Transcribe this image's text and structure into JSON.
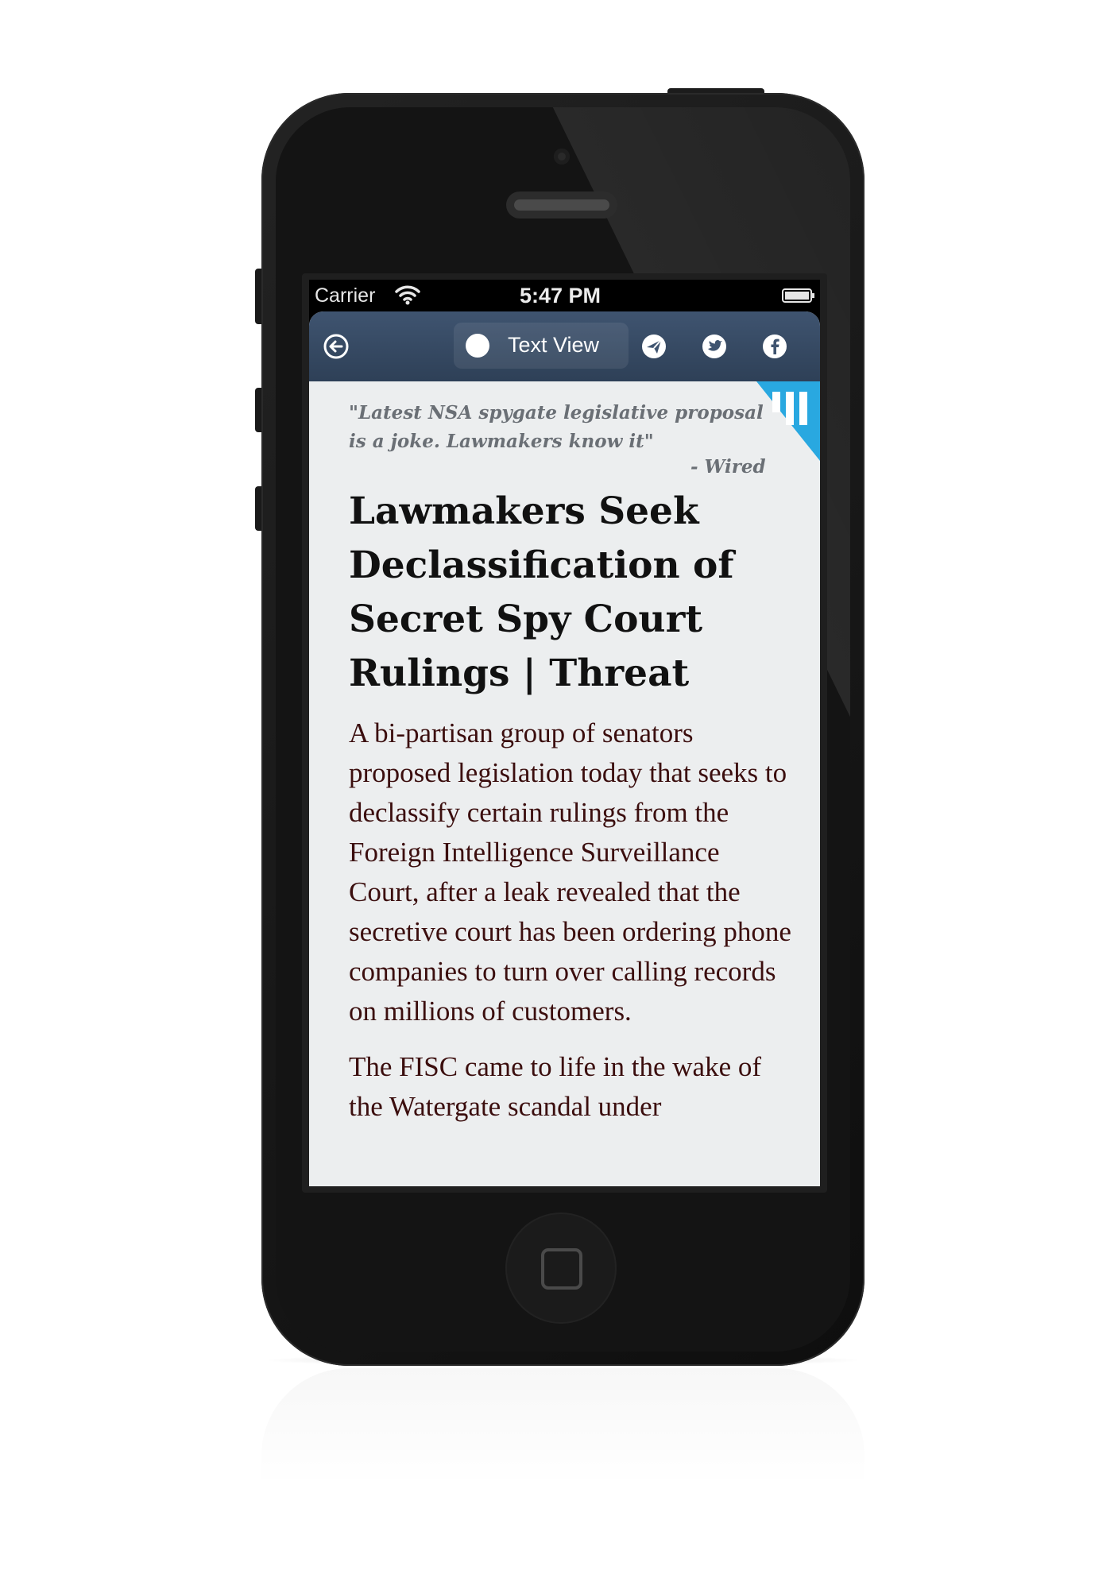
{
  "status_bar": {
    "carrier": "Carrier",
    "time": "5:47 PM",
    "wifi_icon": "wifi-icon",
    "battery_icon": "battery-icon"
  },
  "toolbar": {
    "back_icon": "back-arrow-icon",
    "text_view_label": "Text View",
    "text_view_icon": "white-dot-icon",
    "send_icon": "paper-plane-icon",
    "twitter_icon": "twitter-bird-icon",
    "facebook_icon": "facebook-icon",
    "bg_color": "#3f5470"
  },
  "article": {
    "quote": "\"Latest NSA spygate legislative proposal is a joke. Lawmakers know it\"",
    "quote_source": "- Wired",
    "headline": "Lawmakers Seek Declassification of Secret Spy Court Rulings | Threat",
    "paragraphs": [
      "A bi-partisan group of senators proposed legislation today that seeks to declassify certain rulings from the Foreign Intelligence Surveillance Court, after a leak revealed that the secretive court has been ordering phone companies to turn over calling records on millions of customers.",
      "The FISC came to life in the wake of the Watergate scandal under"
    ],
    "corner_badge_icon": "quote-flag-icon",
    "accent_color": "#29a8e0"
  },
  "device": {
    "home_button_icon": "home-square-icon"
  }
}
